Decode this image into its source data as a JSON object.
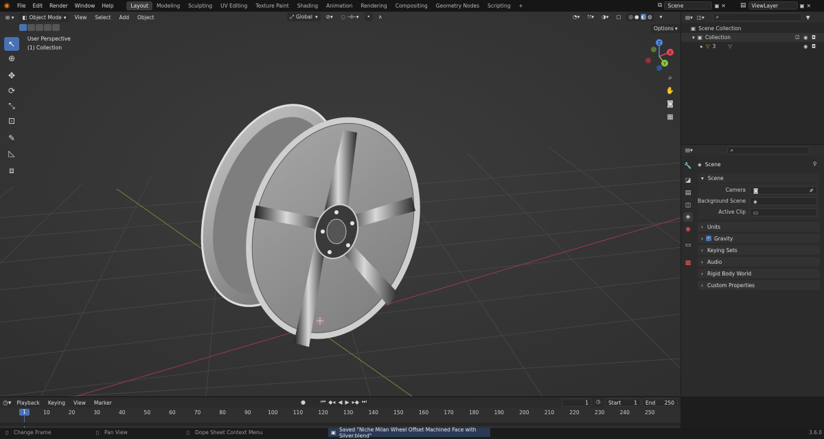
{
  "topbar": {
    "menus": [
      "File",
      "Edit",
      "Render",
      "Window",
      "Help"
    ],
    "workspaces": [
      "Layout",
      "Modeling",
      "Sculpting",
      "UV Editing",
      "Texture Paint",
      "Shading",
      "Animation",
      "Rendering",
      "Compositing",
      "Geometry Nodes",
      "Scripting"
    ],
    "active_workspace": "Layout",
    "add_tab": "+",
    "scene": "Scene",
    "view_layer": "ViewLayer"
  },
  "viewport": {
    "mode": "Object Mode",
    "menus": [
      "View",
      "Select",
      "Add",
      "Object"
    ],
    "orientation": "Global",
    "options_label": "Options",
    "overlay_title": "User Perspective",
    "overlay_subtitle": "(1) Collection",
    "gizmo_labels": {
      "x": "X",
      "y": "Y",
      "z": "Z"
    }
  },
  "outliner": {
    "root": "Scene Collection",
    "collection": "Collection",
    "object": "3"
  },
  "properties": {
    "tab_title": "Scene",
    "section_title": "Scene",
    "fields": [
      {
        "label": "Camera"
      },
      {
        "label": "Background Scene"
      },
      {
        "label": "Active Clip"
      }
    ],
    "panels": [
      "Units",
      "Gravity",
      "Keying Sets",
      "Audio",
      "Rigid Body World",
      "Custom Properties"
    ]
  },
  "timeline": {
    "menus": [
      "Playback",
      "Keying",
      "View",
      "Marker"
    ],
    "current_frame": "1",
    "start_label": "Start",
    "start_value": "1",
    "end_label": "End",
    "end_value": "250",
    "ruler_current": "1",
    "ruler_ticks": [
      "10",
      "20",
      "30",
      "40",
      "50",
      "60",
      "70",
      "80",
      "90",
      "100",
      "110",
      "120",
      "130",
      "140",
      "150",
      "160",
      "170",
      "180",
      "190",
      "200",
      "210",
      "220",
      "230",
      "240",
      "250"
    ]
  },
  "status": {
    "hint1": "Change Frame",
    "hint2": "Pan View",
    "hint3": "Dope Sheet Context Menu",
    "message": "Saved \"Niche Milan Wheel Offset Machined Face with Silver.blend\"",
    "version": "3.6.0"
  },
  "colors": {
    "accent": "#4772b3",
    "axis_x": "#e8445a",
    "axis_y": "#8cc63f",
    "axis_z": "#4c8be8"
  }
}
